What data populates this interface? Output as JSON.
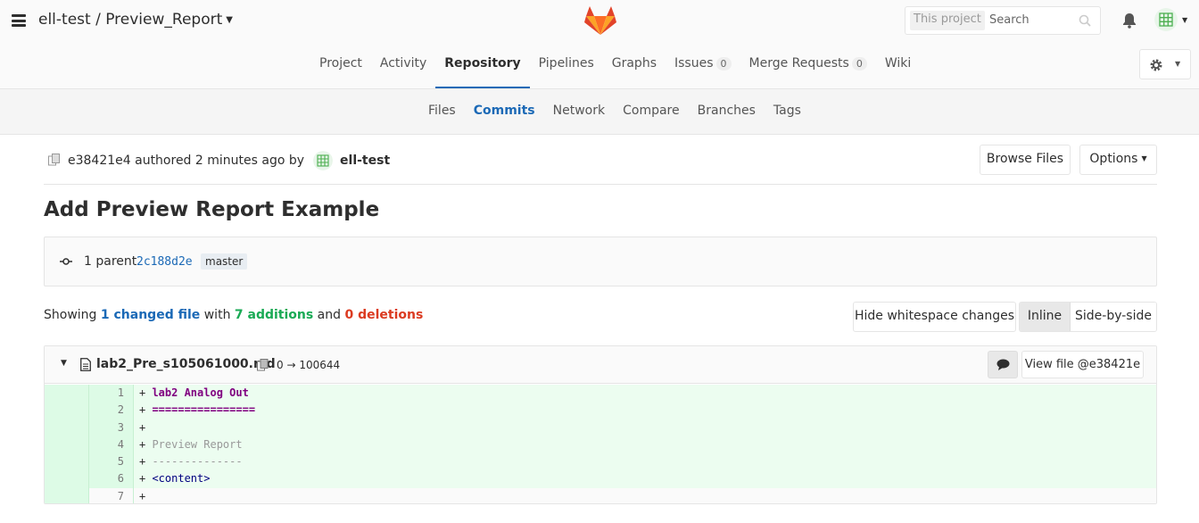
{
  "header": {
    "project_path": "ell-test / Preview_Report",
    "search_scope": "This project",
    "search_placeholder": "Search"
  },
  "nav": {
    "items": [
      {
        "label": "Project"
      },
      {
        "label": "Activity"
      },
      {
        "label": "Repository",
        "active": true
      },
      {
        "label": "Pipelines"
      },
      {
        "label": "Graphs"
      },
      {
        "label": "Issues",
        "badge": "0"
      },
      {
        "label": "Merge Requests",
        "badge": "0"
      },
      {
        "label": "Wiki"
      }
    ]
  },
  "subnav": {
    "items": [
      {
        "label": "Files"
      },
      {
        "label": "Commits",
        "active": true
      },
      {
        "label": "Network"
      },
      {
        "label": "Compare"
      },
      {
        "label": "Branches"
      },
      {
        "label": "Tags"
      }
    ]
  },
  "commit": {
    "meta": "e38421e4 authored 2 minutes ago by",
    "author": "ell-test",
    "browse_files": "Browse Files",
    "options": "Options",
    "title": "Add Preview Report Example",
    "parent_label": "1 parent",
    "parent_sha": "2c188d2e",
    "branch": "master"
  },
  "stats": {
    "showing": "Showing",
    "changed_files": "1 changed file",
    "with": "with",
    "additions": "7 additions",
    "and": "and",
    "deletions": "0 deletions"
  },
  "diff_controls": {
    "hide_whitespace": "Hide whitespace changes",
    "inline": "Inline",
    "side_by_side": "Side-by-side"
  },
  "file": {
    "name": "lab2_Pre_s105061000.md",
    "mode": "0 → 100644",
    "view_file": "View file @e38421e",
    "lines": [
      {
        "num": "1",
        "prefix": "+ ",
        "text": "lab2 Analog Out",
        "style": "purple"
      },
      {
        "num": "2",
        "prefix": "+ ",
        "text": "================",
        "style": "purple"
      },
      {
        "num": "3",
        "prefix": "+",
        "text": "",
        "style": ""
      },
      {
        "num": "4",
        "prefix": "+ ",
        "text": "Preview Report",
        "style": "gray"
      },
      {
        "num": "5",
        "prefix": "+ ",
        "text": "--------------",
        "style": "gray"
      },
      {
        "num": "6",
        "prefix": "+ ",
        "text": "<content>",
        "style": "tag"
      },
      {
        "num": "7",
        "prefix": "+",
        "text": "",
        "style": ""
      }
    ]
  },
  "colors": {
    "accent": "#1b69b6",
    "additions": "#1aaa55",
    "deletions": "#db3b21",
    "diff_added_bg": "#ecfdf0"
  }
}
